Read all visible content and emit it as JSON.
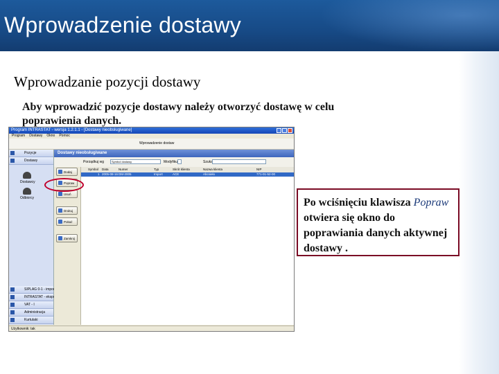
{
  "slide": {
    "title": "Wprowadzenie dostawy",
    "subtitle": "Wprowadzanie pozycji dostawy",
    "paragraph": "Aby wprowadzić pozycje dostawy należy otworzyć dostawę w celu poprawienia danych.",
    "callout": {
      "text_before": "Po wciśnięciu klawisza ",
      "emphasis": "Popraw",
      "text_after": " otwiera się okno do poprawiania danych aktywnej dostawy ."
    }
  },
  "colors": {
    "header": "#1d5a9c",
    "callout_border": "#7a0a24",
    "highlight": "#c0002c"
  },
  "app": {
    "window_title": "Program INTRASTAT - wersja 1.2.1.1 - [Dostawy nieobsługiwane]",
    "menu": [
      "Program",
      "Dostawy",
      "Okno",
      "Pomoc"
    ],
    "toolbar_text": "Wprowadzenie dostaw",
    "nav_top": [
      "Pozycje",
      "Dostawy"
    ],
    "nav_icons": [
      "Dostawcy",
      "Odbiorcy"
    ],
    "nav_bottom": [
      "SIPLAG 0-1 - import",
      "INTRASTAT - eksport",
      "VAT - I",
      "Administracja",
      "Kurtulaki"
    ],
    "panel_title": "Dostawy nieobsługiwane",
    "filters": {
      "sort_label": "Porządkuj wg",
      "sort_value": "Symbol dostawy",
      "filter_label": "Modyfikuj",
      "search_label": "Szukaj"
    },
    "side_buttons": [
      "Dodaj",
      "Popraw",
      "Usuń",
      "Drukuj",
      "Pokaż",
      "Zamknij"
    ],
    "grid_columns": [
      "Symbol",
      "Data",
      "Numer",
      "Typ",
      "Skrót klienta",
      "Nazwa klienta",
      "NIP"
    ],
    "grid_row": [
      "1",
      "2005-08-16",
      "DM-2005",
      "Import",
      "ACE",
      "Abcsieło",
      "771-01-52-00"
    ],
    "status": "Użytkownik: tak"
  }
}
